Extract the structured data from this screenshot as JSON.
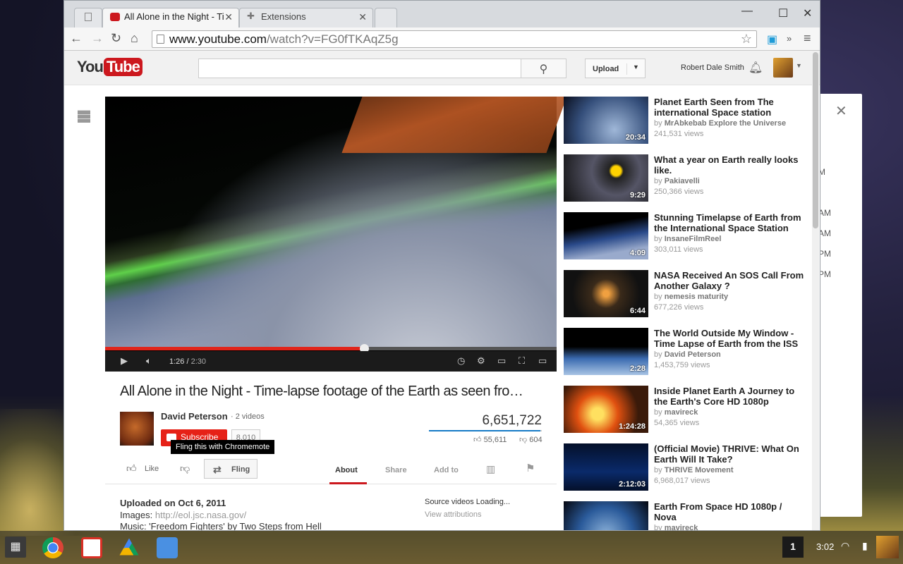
{
  "browser": {
    "tabs": [
      {
        "title": ""
      },
      {
        "title": "All Alone in the Night - Ti"
      },
      {
        "title": "Extensions"
      }
    ],
    "url_host": "www.youtube.com",
    "url_path": "/watch?v=FG0fTKAqZ5g"
  },
  "masthead": {
    "logo_you": "You",
    "logo_tube": "Tube",
    "upload_label": "Upload",
    "user_name": "Robert Dale Smith"
  },
  "player": {
    "current_time": "1:26",
    "duration": "2:30",
    "progress_fraction": 0.573
  },
  "video": {
    "title": "All Alone in the Night - Time-lapse footage of the Earth as seen fro…",
    "owner": "David Peterson",
    "owner_videos": "2 videos",
    "subscribe_label": "Subscribe",
    "subscriber_count": "8,010",
    "views": "6,651,722",
    "likes": "55,611",
    "dislikes": "604",
    "like_fraction": 0.989,
    "tooltip": "Fling this with Chromemote"
  },
  "actions": {
    "like": "Like",
    "fling": "Fling",
    "about": "About",
    "share": "Share",
    "add_to": "Add to"
  },
  "description": {
    "uploaded": "Uploaded on Oct 6, 2011",
    "images_label": "Images:",
    "images_link": "http://eol.jsc.nasa.gov/",
    "music": "Music: 'Freedom Fighters' by Two Steps from Hell",
    "source_loading": "Source videos Loading...",
    "view_attributions": "View attributions"
  },
  "related": [
    {
      "title": "Planet Earth Seen from The international Space station",
      "channel": "MrAbkebab Explore the Universe",
      "views": "241,531 views",
      "duration": "20:34"
    },
    {
      "title": "What a year on Earth really looks like.",
      "channel": "Pakiavelli",
      "views": "250,366 views",
      "duration": "9:29"
    },
    {
      "title": "Stunning Timelapse of Earth from the International Space Station",
      "channel": "InsaneFilmReel",
      "views": "303,011 views",
      "duration": "4:09"
    },
    {
      "title": "NASA Received An SOS Call From Another Galaxy ?",
      "channel": "nemesis maturity",
      "views": "677,226 views",
      "duration": "6:44"
    },
    {
      "title": "The World Outside My Window - Time Lapse of Earth from the ISS",
      "channel": "David Peterson",
      "views": "1,453,759 views",
      "duration": "2:28"
    },
    {
      "title": "Inside Planet Earth A Journey to the Earth's Core HD 1080p",
      "channel": "mavireck",
      "views": "54,365 views",
      "duration": "1:24:28"
    },
    {
      "title": "(Official Movie) THRIVE: What On Earth Will It Take?",
      "channel": "THRIVE Movement",
      "views": "6,968,017 views",
      "duration": "2:12:03"
    },
    {
      "title": "Earth From Space HD 1080p / Nova",
      "channel": "mavireck",
      "views": "",
      "duration": ""
    }
  ],
  "related_by_label": "by",
  "side_panel_stubs": [
    "M",
    "AM",
    "AM",
    "PM",
    "PM"
  ],
  "shelf": {
    "notification_count": "1",
    "time": "3:02"
  },
  "colors": {
    "youtube_red": "#cc181e",
    "subscribe_red": "#e62117",
    "like_blue": "#167ac6"
  }
}
